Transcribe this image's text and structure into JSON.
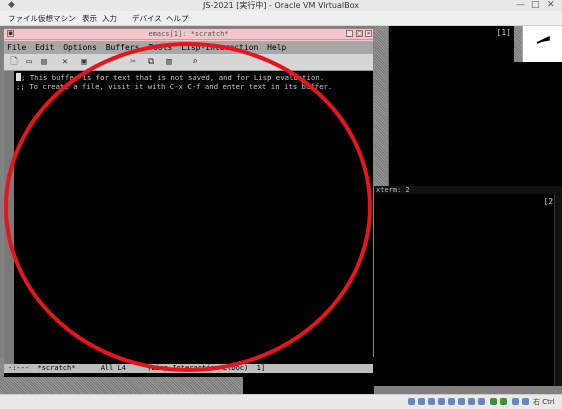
{
  "host": {
    "title": "JS-2021 [実行中] - Oracle VM VirtualBox",
    "menu": [
      "ファイル",
      "仮想マシン",
      "表示",
      "入力",
      "デバイス",
      "ヘルプ"
    ],
    "host_key": "右 Ctrl"
  },
  "guest": {
    "xterm_top_label": "[1]",
    "xterm_mid_title": "xterm: 2",
    "xterm_mid_label": "[2]"
  },
  "emacs": {
    "title": "emacs[1]: *scratch*",
    "menu": [
      "File",
      "Edit",
      "Options",
      "Buffers",
      "Tools",
      "Lisp-Interaction",
      "Help"
    ],
    "toolbar_icons": [
      "new-file-icon",
      "open-folder-icon",
      "open-dir-icon",
      "close-x-icon",
      "save-icon",
      "undo-icon",
      "cut-icon",
      "copy-icon",
      "paste-icon",
      "search-icon"
    ],
    "buffer_lines": [
      "; This buffer is for text that is not saved, and for Lisp evaluation.",
      ";; To create a file, visit it with C-x C-f and enter text in its buffer."
    ],
    "modeline": "-:---  *scratch*      All L4     (Lisp Interaction ElDoc)  1]"
  },
  "colors": {
    "emacs_frame": "#f3c7c9",
    "annotation_circle": "#e8141b"
  }
}
